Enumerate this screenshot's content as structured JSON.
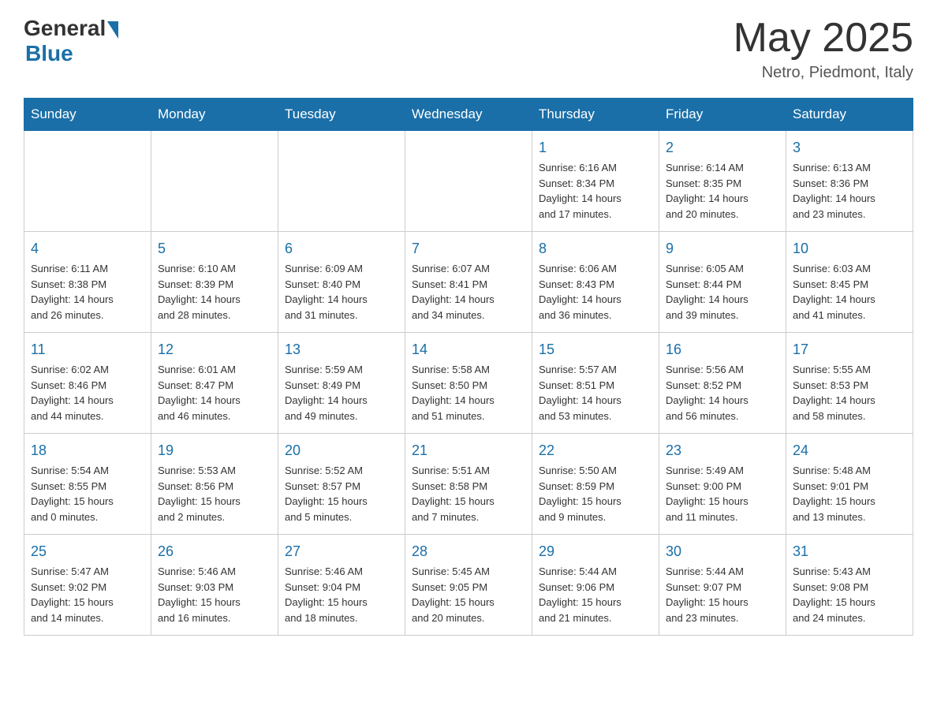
{
  "logo": {
    "general": "General",
    "blue": "Blue"
  },
  "title": "May 2025",
  "location": "Netro, Piedmont, Italy",
  "days_of_week": [
    "Sunday",
    "Monday",
    "Tuesday",
    "Wednesday",
    "Thursday",
    "Friday",
    "Saturday"
  ],
  "weeks": [
    [
      {
        "day": "",
        "info": ""
      },
      {
        "day": "",
        "info": ""
      },
      {
        "day": "",
        "info": ""
      },
      {
        "day": "",
        "info": ""
      },
      {
        "day": "1",
        "info": "Sunrise: 6:16 AM\nSunset: 8:34 PM\nDaylight: 14 hours\nand 17 minutes."
      },
      {
        "day": "2",
        "info": "Sunrise: 6:14 AM\nSunset: 8:35 PM\nDaylight: 14 hours\nand 20 minutes."
      },
      {
        "day": "3",
        "info": "Sunrise: 6:13 AM\nSunset: 8:36 PM\nDaylight: 14 hours\nand 23 minutes."
      }
    ],
    [
      {
        "day": "4",
        "info": "Sunrise: 6:11 AM\nSunset: 8:38 PM\nDaylight: 14 hours\nand 26 minutes."
      },
      {
        "day": "5",
        "info": "Sunrise: 6:10 AM\nSunset: 8:39 PM\nDaylight: 14 hours\nand 28 minutes."
      },
      {
        "day": "6",
        "info": "Sunrise: 6:09 AM\nSunset: 8:40 PM\nDaylight: 14 hours\nand 31 minutes."
      },
      {
        "day": "7",
        "info": "Sunrise: 6:07 AM\nSunset: 8:41 PM\nDaylight: 14 hours\nand 34 minutes."
      },
      {
        "day": "8",
        "info": "Sunrise: 6:06 AM\nSunset: 8:43 PM\nDaylight: 14 hours\nand 36 minutes."
      },
      {
        "day": "9",
        "info": "Sunrise: 6:05 AM\nSunset: 8:44 PM\nDaylight: 14 hours\nand 39 minutes."
      },
      {
        "day": "10",
        "info": "Sunrise: 6:03 AM\nSunset: 8:45 PM\nDaylight: 14 hours\nand 41 minutes."
      }
    ],
    [
      {
        "day": "11",
        "info": "Sunrise: 6:02 AM\nSunset: 8:46 PM\nDaylight: 14 hours\nand 44 minutes."
      },
      {
        "day": "12",
        "info": "Sunrise: 6:01 AM\nSunset: 8:47 PM\nDaylight: 14 hours\nand 46 minutes."
      },
      {
        "day": "13",
        "info": "Sunrise: 5:59 AM\nSunset: 8:49 PM\nDaylight: 14 hours\nand 49 minutes."
      },
      {
        "day": "14",
        "info": "Sunrise: 5:58 AM\nSunset: 8:50 PM\nDaylight: 14 hours\nand 51 minutes."
      },
      {
        "day": "15",
        "info": "Sunrise: 5:57 AM\nSunset: 8:51 PM\nDaylight: 14 hours\nand 53 minutes."
      },
      {
        "day": "16",
        "info": "Sunrise: 5:56 AM\nSunset: 8:52 PM\nDaylight: 14 hours\nand 56 minutes."
      },
      {
        "day": "17",
        "info": "Sunrise: 5:55 AM\nSunset: 8:53 PM\nDaylight: 14 hours\nand 58 minutes."
      }
    ],
    [
      {
        "day": "18",
        "info": "Sunrise: 5:54 AM\nSunset: 8:55 PM\nDaylight: 15 hours\nand 0 minutes."
      },
      {
        "day": "19",
        "info": "Sunrise: 5:53 AM\nSunset: 8:56 PM\nDaylight: 15 hours\nand 2 minutes."
      },
      {
        "day": "20",
        "info": "Sunrise: 5:52 AM\nSunset: 8:57 PM\nDaylight: 15 hours\nand 5 minutes."
      },
      {
        "day": "21",
        "info": "Sunrise: 5:51 AM\nSunset: 8:58 PM\nDaylight: 15 hours\nand 7 minutes."
      },
      {
        "day": "22",
        "info": "Sunrise: 5:50 AM\nSunset: 8:59 PM\nDaylight: 15 hours\nand 9 minutes."
      },
      {
        "day": "23",
        "info": "Sunrise: 5:49 AM\nSunset: 9:00 PM\nDaylight: 15 hours\nand 11 minutes."
      },
      {
        "day": "24",
        "info": "Sunrise: 5:48 AM\nSunset: 9:01 PM\nDaylight: 15 hours\nand 13 minutes."
      }
    ],
    [
      {
        "day": "25",
        "info": "Sunrise: 5:47 AM\nSunset: 9:02 PM\nDaylight: 15 hours\nand 14 minutes."
      },
      {
        "day": "26",
        "info": "Sunrise: 5:46 AM\nSunset: 9:03 PM\nDaylight: 15 hours\nand 16 minutes."
      },
      {
        "day": "27",
        "info": "Sunrise: 5:46 AM\nSunset: 9:04 PM\nDaylight: 15 hours\nand 18 minutes."
      },
      {
        "day": "28",
        "info": "Sunrise: 5:45 AM\nSunset: 9:05 PM\nDaylight: 15 hours\nand 20 minutes."
      },
      {
        "day": "29",
        "info": "Sunrise: 5:44 AM\nSunset: 9:06 PM\nDaylight: 15 hours\nand 21 minutes."
      },
      {
        "day": "30",
        "info": "Sunrise: 5:44 AM\nSunset: 9:07 PM\nDaylight: 15 hours\nand 23 minutes."
      },
      {
        "day": "31",
        "info": "Sunrise: 5:43 AM\nSunset: 9:08 PM\nDaylight: 15 hours\nand 24 minutes."
      }
    ]
  ]
}
